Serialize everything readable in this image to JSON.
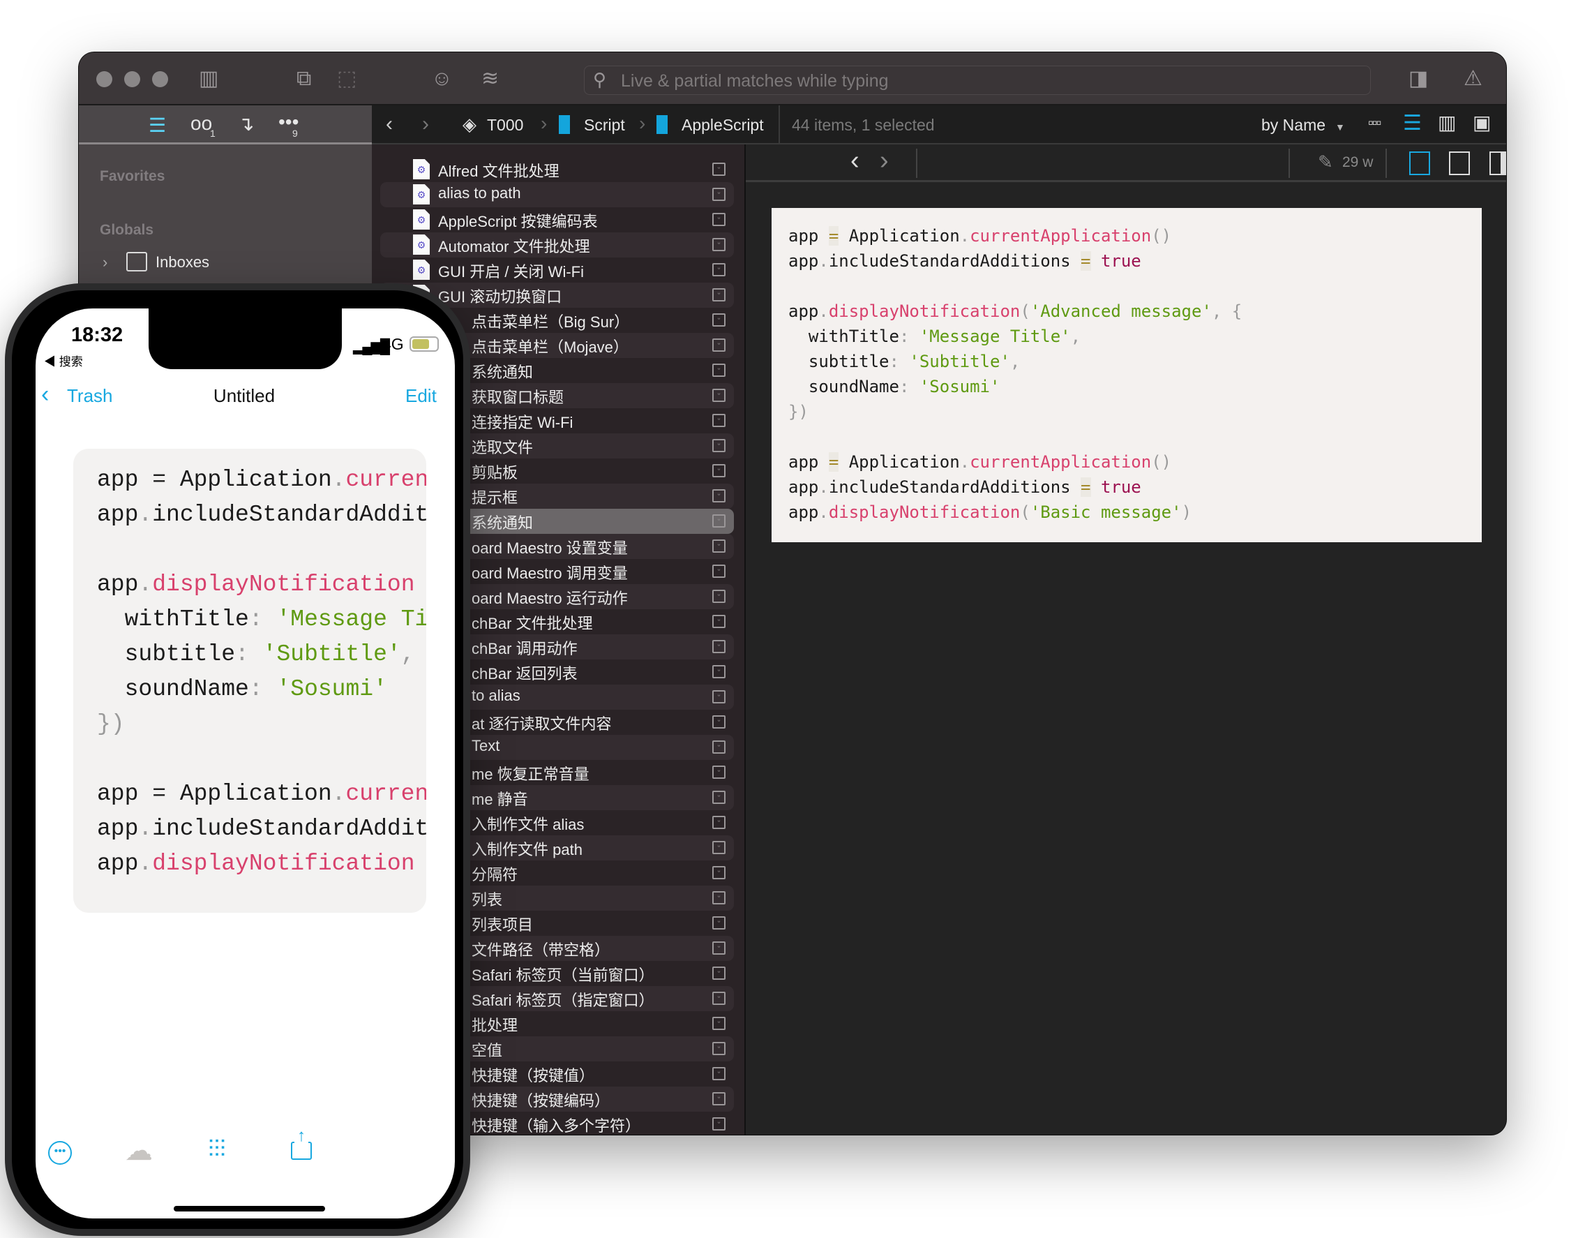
{
  "window": {
    "search_placeholder": "Live & partial matches while typing",
    "sidebar_tab_badges": [
      "1",
      "9"
    ],
    "breadcrumb": [
      "T000",
      "Script",
      "AppleScript"
    ],
    "status": "44 items, 1 selected",
    "sort": "by Name",
    "word_count": "29 w",
    "accent": "#1aa8e0"
  },
  "sidebar": {
    "favorites": "Favorites",
    "globals": "Globals",
    "inboxes": "Inboxes"
  },
  "list": {
    "selected_index": 14,
    "items": [
      "Alfred 文件批处理",
      "alias to path",
      "AppleScript 按键编码表",
      "Automator 文件批处理",
      "GUI 开启 / 关闭 Wi-Fi",
      "GUI 滚动切换窗口",
      "点击菜单栏（Big Sur）",
      "点击菜单栏（Mojave）",
      "系统通知",
      "获取窗口标题",
      "连接指定 Wi-Fi",
      "选取文件",
      "剪贴板",
      "提示框",
      "系统通知",
      "oard Maestro 设置变量",
      "oard Maestro 调用变量",
      "oard Maestro 运行动作",
      "chBar 文件批处理",
      "chBar 调用动作",
      "chBar 返回列表",
      "to alias",
      "at 逐行读取文件内容",
      "Text",
      "me 恢复正常音量",
      "me 静音",
      "入制作文件 alias",
      "入制作文件 path",
      "分隔符",
      "列表",
      "列表项目",
      "文件路径（带空格）",
      "Safari 标签页（当前窗口）",
      "Safari 标签页（指定窗口）",
      "批处理",
      "空值",
      "快捷键（按键值）",
      "快捷键（按键编码）",
      "快捷键（输入多个字符）"
    ]
  },
  "editor_code": [
    [
      [
        "app",
        "id"
      ],
      [
        " ",
        "id"
      ],
      [
        "=",
        "op"
      ],
      [
        " Application",
        "id"
      ],
      [
        ".",
        "punc"
      ],
      [
        "currentApplication",
        "fn"
      ],
      [
        "()",
        "punc"
      ]
    ],
    [
      [
        "app",
        "id"
      ],
      [
        ".",
        "punc"
      ],
      [
        "includeStandardAdditions ",
        "id"
      ],
      [
        "=",
        "op"
      ],
      [
        " ",
        "id"
      ],
      [
        "true",
        "kw"
      ]
    ],
    [],
    [
      [
        "app",
        "id"
      ],
      [
        ".",
        "punc"
      ],
      [
        "displayNotification",
        "fn"
      ],
      [
        "(",
        "punc"
      ],
      [
        "'Advanced message'",
        "str"
      ],
      [
        ", {",
        "punc"
      ]
    ],
    [
      [
        "  withTitle",
        "id"
      ],
      [
        ":",
        "punc"
      ],
      [
        " ",
        "id"
      ],
      [
        "'Message Title'",
        "str"
      ],
      [
        ",",
        "punc"
      ]
    ],
    [
      [
        "  subtitle",
        "id"
      ],
      [
        ":",
        "punc"
      ],
      [
        " ",
        "id"
      ],
      [
        "'Subtitle'",
        "str"
      ],
      [
        ",",
        "punc"
      ]
    ],
    [
      [
        "  soundName",
        "id"
      ],
      [
        ":",
        "punc"
      ],
      [
        " ",
        "id"
      ],
      [
        "'Sosumi'",
        "str"
      ]
    ],
    [
      [
        "})",
        "punc"
      ]
    ],
    [],
    [
      [
        "app",
        "id"
      ],
      [
        " ",
        "id"
      ],
      [
        "=",
        "op"
      ],
      [
        " Application",
        "id"
      ],
      [
        ".",
        "punc"
      ],
      [
        "currentApplication",
        "fn"
      ],
      [
        "()",
        "punc"
      ]
    ],
    [
      [
        "app",
        "id"
      ],
      [
        ".",
        "punc"
      ],
      [
        "includeStandardAdditions ",
        "id"
      ],
      [
        "=",
        "op"
      ],
      [
        " ",
        "id"
      ],
      [
        "true",
        "kw"
      ]
    ],
    [
      [
        "app",
        "id"
      ],
      [
        ".",
        "punc"
      ],
      [
        "displayNotification",
        "fn"
      ],
      [
        "(",
        "punc"
      ],
      [
        "'Basic message'",
        "str"
      ],
      [
        ")",
        "punc"
      ]
    ]
  ],
  "phone": {
    "time": "18:32",
    "back_app": "◀ 搜索",
    "network": "4G",
    "battery_level": 0.7,
    "nav_back": "Trash",
    "title": "Untitled",
    "edit": "Edit",
    "code": [
      [
        [
          "app = Application",
          "id"
        ],
        [
          ".",
          "punc"
        ],
        [
          "curren",
          "fn"
        ]
      ],
      [
        [
          "app",
          "id"
        ],
        [
          ".",
          "punc"
        ],
        [
          "includeStandardAddit",
          "id"
        ]
      ],
      [],
      [
        [
          "app",
          "id"
        ],
        [
          ".",
          "punc"
        ],
        [
          "displayNotification",
          "fn"
        ]
      ],
      [
        [
          "  withTitle",
          "id"
        ],
        [
          ":",
          "punc"
        ],
        [
          " ",
          "id"
        ],
        [
          "'Message Ti",
          "str"
        ]
      ],
      [
        [
          "  subtitle",
          "id"
        ],
        [
          ":",
          "punc"
        ],
        [
          " ",
          "id"
        ],
        [
          "'Subtitle'",
          "str"
        ],
        [
          ",",
          "punc"
        ]
      ],
      [
        [
          "  soundName",
          "id"
        ],
        [
          ":",
          "punc"
        ],
        [
          " ",
          "id"
        ],
        [
          "'Sosumi'",
          "str"
        ]
      ],
      [
        [
          "})",
          "punc"
        ]
      ],
      [],
      [
        [
          "app = Application",
          "id"
        ],
        [
          ".",
          "punc"
        ],
        [
          "curren",
          "fn"
        ]
      ],
      [
        [
          "app",
          "id"
        ],
        [
          ".",
          "punc"
        ],
        [
          "includeStandardAddit",
          "id"
        ]
      ],
      [
        [
          "app",
          "id"
        ],
        [
          ".",
          "punc"
        ],
        [
          "displayNotification",
          "fn"
        ]
      ]
    ]
  }
}
